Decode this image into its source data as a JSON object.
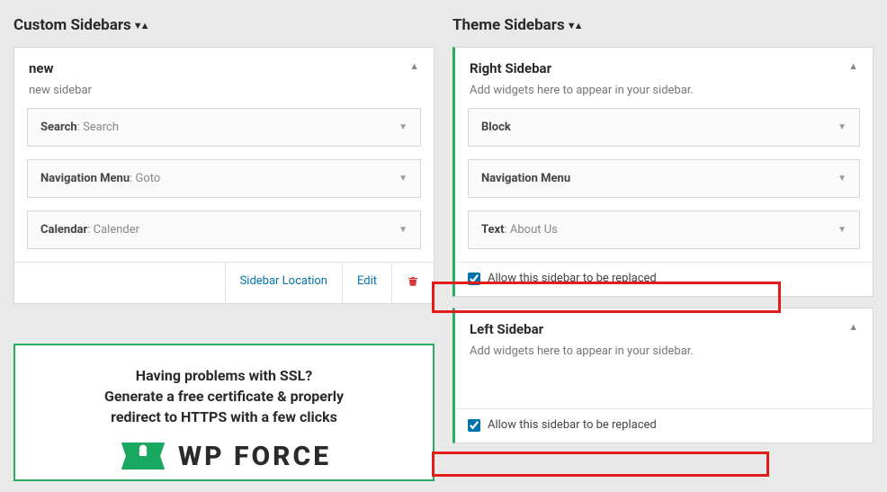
{
  "custom": {
    "heading": "Custom Sidebars",
    "panel": {
      "title": "new",
      "desc": "new sidebar",
      "widgets": [
        {
          "name": "Search",
          "sub": "Search"
        },
        {
          "name": "Navigation Menu",
          "sub": "Goto"
        },
        {
          "name": "Calendar",
          "sub": "Calender"
        }
      ],
      "actions": {
        "location": "Sidebar Location",
        "edit": "Edit"
      }
    },
    "promo": {
      "line1": "Having problems with SSL?",
      "line2": "Generate a free certificate & properly",
      "line3": "redirect to HTTPS with a few clicks",
      "logo_text": "WP FORCE"
    }
  },
  "theme": {
    "heading": "Theme Sidebars",
    "right": {
      "title": "Right Sidebar",
      "desc": "Add widgets here to appear in your sidebar.",
      "widgets": [
        {
          "name": "Block",
          "sub": ""
        },
        {
          "name": "Navigation Menu",
          "sub": ""
        },
        {
          "name": "Text",
          "sub": "About Us"
        }
      ],
      "allow": "Allow this sidebar to be replaced"
    },
    "left": {
      "title": "Left Sidebar",
      "desc": "Add widgets here to appear in your sidebar.",
      "allow": "Allow this sidebar to be replaced"
    }
  }
}
